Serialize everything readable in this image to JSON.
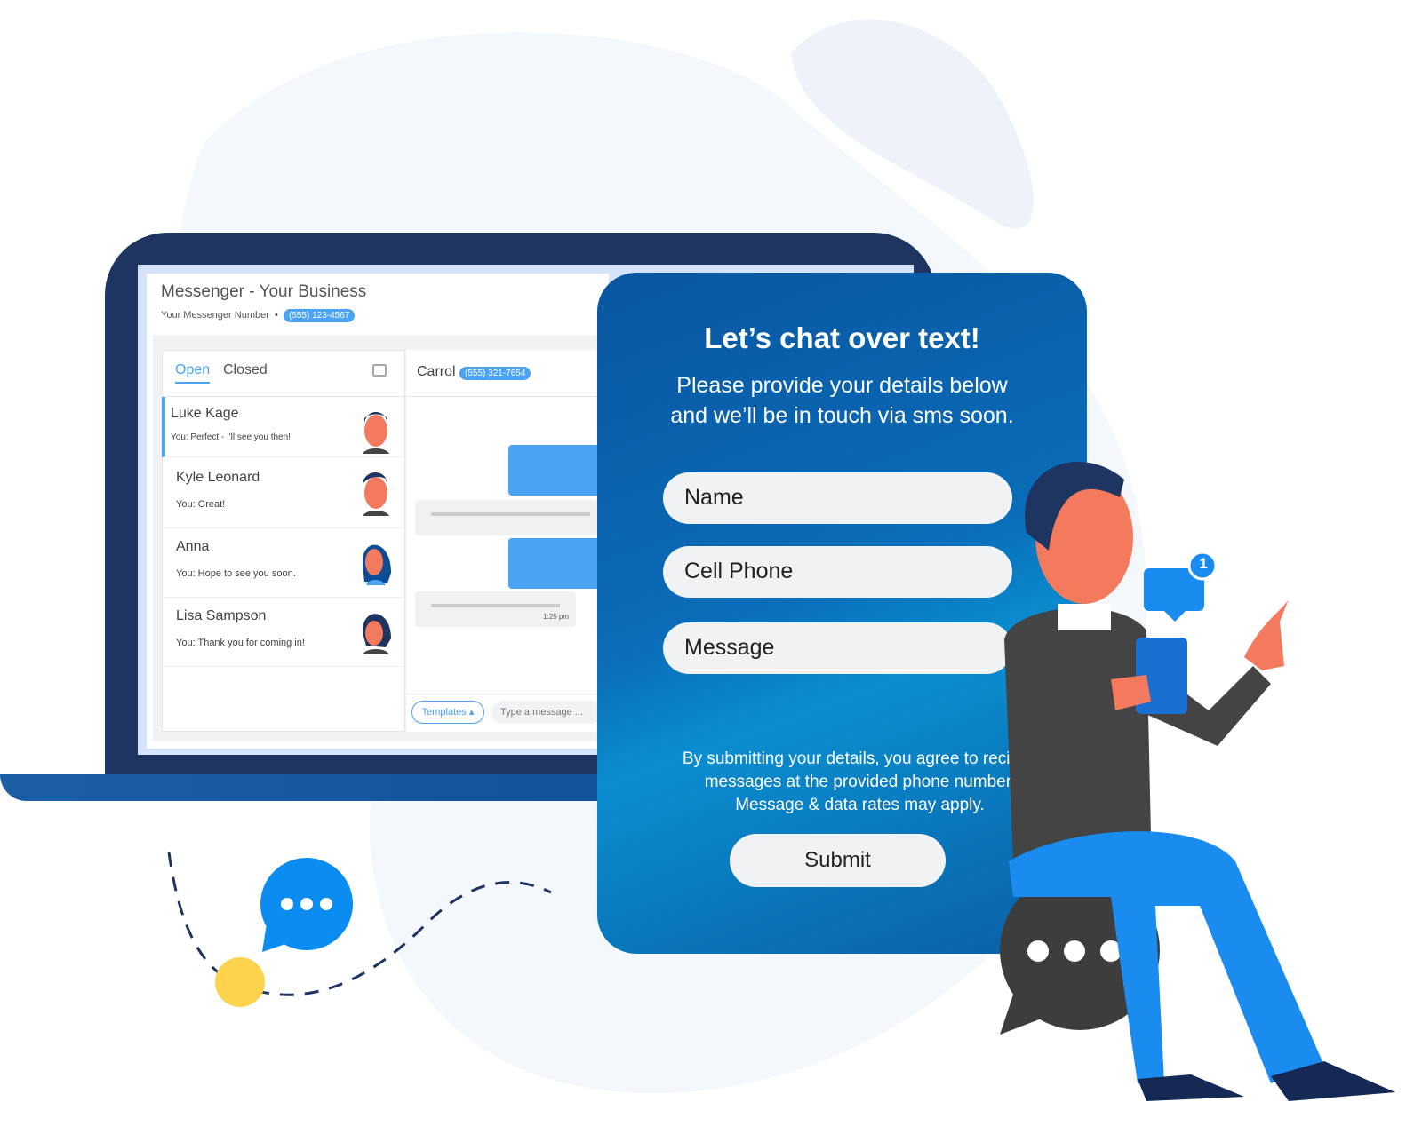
{
  "colors": {
    "laptop": "#1e3461",
    "accent": "#4aa3f5",
    "form_bg": "#0a6cb8",
    "yellow": "#fdd24d"
  },
  "messenger": {
    "title": "Messenger - Your Business",
    "number_label": "Your Messenger Number",
    "number": "(555) 123-4567",
    "tabs": [
      {
        "label": "Open",
        "active": true
      },
      {
        "label": "Closed",
        "active": false
      }
    ],
    "compose_icon": "edit-icon",
    "conversations": [
      {
        "name": "Luke Kage",
        "preview": "You: Perfect - I'll see you then!",
        "selected": true
      },
      {
        "name": "Kyle Leonard",
        "preview": "You: Great!"
      },
      {
        "name": "Anna",
        "preview": "You: Hope to see you soon."
      },
      {
        "name": "Lisa Sampson",
        "preview": "You: Thank you for coming in!"
      }
    ],
    "contact": {
      "name": "Carrol",
      "phone": "(555) 321-7654"
    },
    "message_time": "1:25 pm",
    "templates_label": "Templates ▴",
    "input_placeholder": "Type a message ..."
  },
  "form": {
    "title": "Let’s chat over text!",
    "subtitle_lines": [
      "Please provide your details below",
      "and we’ll be in touch via sms soon."
    ],
    "fields": [
      {
        "placeholder": "Name"
      },
      {
        "placeholder": "Cell Phone"
      },
      {
        "placeholder": "Message"
      }
    ],
    "legal_lines": [
      "By submitting your details, you agree to recieve",
      "messages at the provided phone number.",
      "Message & data rates may apply."
    ],
    "submit_label": "Submit"
  },
  "notification_badge": "1"
}
